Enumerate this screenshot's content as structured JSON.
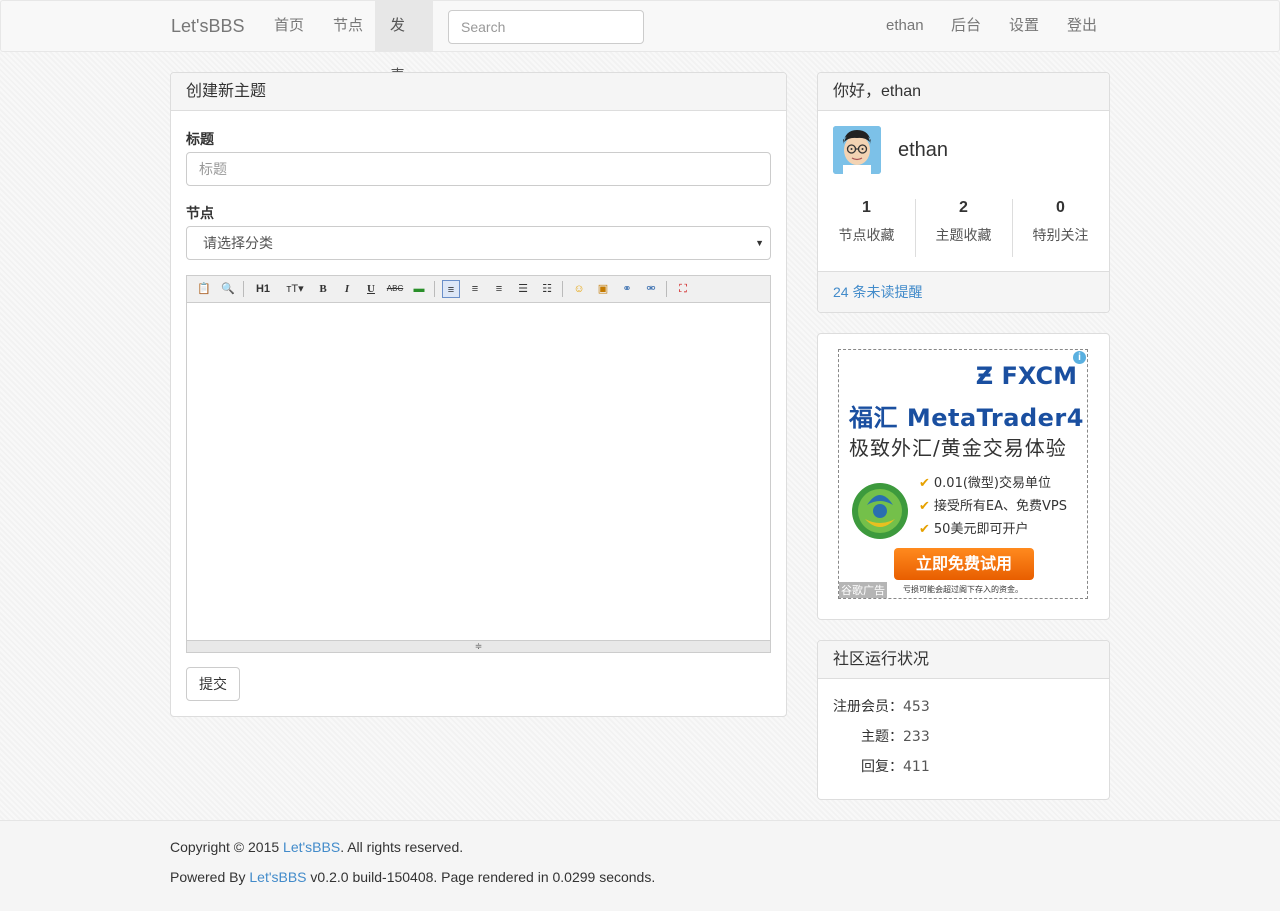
{
  "nav": {
    "brand": "Let'sBBS",
    "items": [
      "首页",
      "节点",
      "发表"
    ],
    "search_placeholder": "Search",
    "right_items": [
      "ethan",
      "后台",
      "设置",
      "登出"
    ]
  },
  "create": {
    "heading": "创建新主题",
    "title_label": "标题",
    "title_placeholder": "标题",
    "node_label": "节点",
    "node_select": "请选择分类",
    "submit": "提交",
    "toolbar": [
      "paste-icon",
      "preview-icon",
      "H1",
      "font-size-icon",
      "B",
      "I",
      "U",
      "ABC",
      "highlight-icon",
      "align-left-icon",
      "align-center-icon",
      "align-right-icon",
      "ordered-list-icon",
      "unordered-list-icon",
      "emoji-icon",
      "image-icon",
      "link-icon",
      "unlink-icon",
      "fullscreen-icon"
    ]
  },
  "user": {
    "greeting": "你好，ethan",
    "name": "ethan",
    "stats": [
      {
        "num": "1",
        "label": "节点收藏"
      },
      {
        "num": "2",
        "label": "主题收藏"
      },
      {
        "num": "0",
        "label": "特别关注"
      }
    ],
    "unread": "24 条未读提醒"
  },
  "ad": {
    "logo": "FXCM",
    "title": "福汇 MetaTrader4",
    "subtitle": "极致外汇/黄金交易体验",
    "bullets": [
      "0.01(微型)交易单位",
      "接受所有EA、免费VPS",
      "50美元即可开户"
    ],
    "cta": "立即免费试用",
    "fine_print": "亏损可能会超过阁下存入的资金。",
    "tag": "谷歌广告"
  },
  "community": {
    "heading": "社区运行状况",
    "members_label": "注册会员：",
    "members": "453",
    "topics_label": "主题：",
    "topics": "233",
    "replies_label": "回复：",
    "replies": "411"
  },
  "footer": {
    "copyright_prefix": "Copyright © 2015 ",
    "site_link": "Let'sBBS",
    "copyright_suffix": ". All rights reserved.",
    "powered_prefix": "Powered By ",
    "powered_suffix": " v0.2.0 build-150408. Page rendered in 0.0299 seconds."
  }
}
